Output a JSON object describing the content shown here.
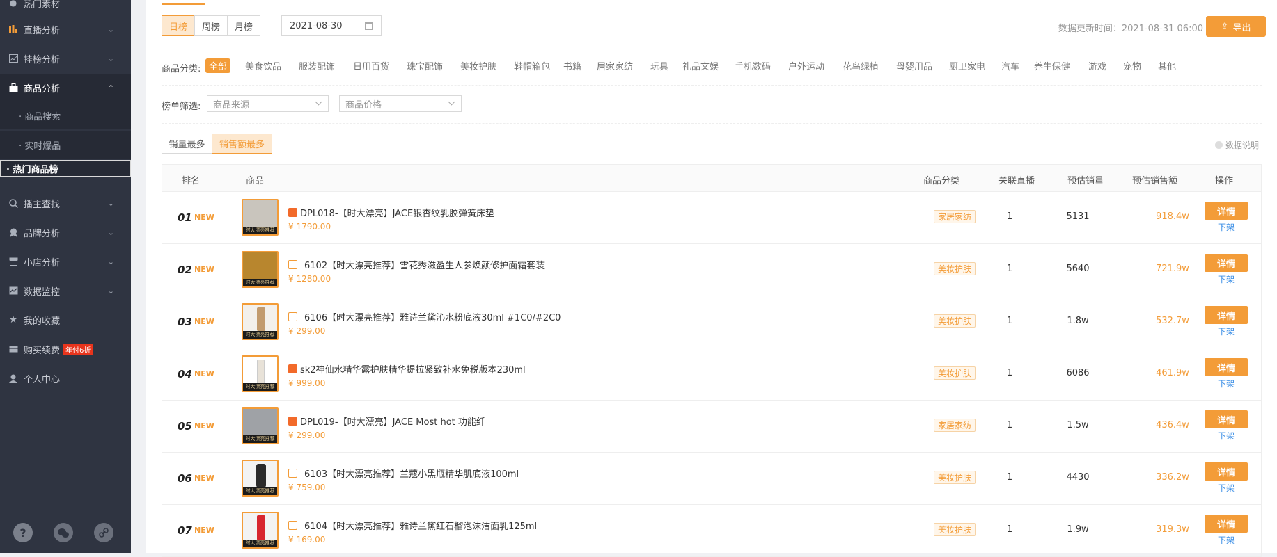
{
  "sidebar": {
    "top_item": "热门素材",
    "nav": [
      {
        "label": "直播分析",
        "icon": "bar-chart-icon"
      },
      {
        "label": "挂榜分析",
        "icon": "line-chart-icon"
      },
      {
        "label": "商品分析",
        "icon": "bag-icon"
      },
      {
        "label": "播主查找",
        "icon": "search-icon"
      },
      {
        "label": "品牌分析",
        "icon": "award-icon"
      },
      {
        "label": "小店分析",
        "icon": "shop-icon"
      },
      {
        "label": "数据监控",
        "icon": "monitor-icon"
      },
      {
        "label": "我的收藏",
        "icon": "star-icon"
      },
      {
        "label": "购买续费",
        "icon": "card-icon",
        "badge": "年付6折"
      },
      {
        "label": "个人中心",
        "icon": "user-icon"
      }
    ],
    "sub": [
      {
        "label": "· 商品搜索"
      },
      {
        "label": "· 实时爆品"
      },
      {
        "label": "· 热门商品榜"
      }
    ],
    "bottom": [
      "help-icon",
      "wechat-icon",
      "link-icon"
    ]
  },
  "toolbar": {
    "tabs": [
      "日榜",
      "周榜",
      "月榜"
    ],
    "date": "2021-08-30",
    "update_text": "数据更新时间：2021-08-31 06:00",
    "export_label": "导出"
  },
  "categories": {
    "label": "商品分类:",
    "items": [
      "全部",
      "美食饮品",
      "服装配饰",
      "日用百货",
      "珠宝配饰",
      "美妆护肤",
      "鞋帽箱包",
      "书籍",
      "居家家纺",
      "玩具",
      "礼品文娱",
      "手机数码",
      "户外运动",
      "花鸟绿植",
      "母婴用品",
      "厨卫家电",
      "汽车",
      "养生保健",
      "游戏",
      "宠物",
      "其他"
    ]
  },
  "filters": {
    "label": "榜单筛选:",
    "source_placeholder": "商品来源",
    "price_placeholder": "商品价格"
  },
  "sort": {
    "options": [
      "销量最多",
      "销售额最多"
    ],
    "info": "数据说明"
  },
  "table": {
    "headers": {
      "rank": "排名",
      "product": "商品",
      "category": "商品分类",
      "live": "关联直播",
      "sales": "预估销量",
      "amount": "预估销售额",
      "op": "操作"
    },
    "new_label": "NEW",
    "detail_label": "详情",
    "off_label": "下架",
    "thumb_caption": "时大漂亮推荐",
    "rows": [
      {
        "rank": "01",
        "title": "DPL018-【时大漂亮】JACE银杏纹乳胶弹簧床垫",
        "price": "¥ 1790.00",
        "category": "家居家纺",
        "live": "1",
        "sales": "5131",
        "amount": "918.4w",
        "platform": "a",
        "thumb": "#c9c5bd"
      },
      {
        "rank": "02",
        "title": "6102【时大漂亮推荐】雪花秀滋盈生人参焕颜修护面霜套装",
        "price": "¥ 1280.00",
        "category": "美妆护肤",
        "live": "1",
        "sales": "5640",
        "amount": "721.9w",
        "platform": "b",
        "thumb": "#b8862e"
      },
      {
        "rank": "03",
        "title": "6106【时大漂亮推荐】雅诗兰黛沁水粉底液30ml #1C0/#2C0",
        "price": "¥ 299.00",
        "category": "美妆护肤",
        "live": "1",
        "sales": "1.8w",
        "amount": "532.7w",
        "platform": "b",
        "thumb": "#c29b6f"
      },
      {
        "rank": "04",
        "title": "sk2神仙水精华露护肤精华提拉紧致补水免税版本230ml",
        "price": "¥ 999.00",
        "category": "美妆护肤",
        "live": "1",
        "sales": "6086",
        "amount": "461.9w",
        "platform": "a",
        "thumb": "#e9e4dd"
      },
      {
        "rank": "05",
        "title": "DPL019-【时大漂亮】JACE Most hot 功能纤",
        "price": "¥ 299.00",
        "category": "家居家纺",
        "live": "1",
        "sales": "1.5w",
        "amount": "436.4w",
        "platform": "a",
        "thumb": "#9fa2a6"
      },
      {
        "rank": "06",
        "title": "6103【时大漂亮推荐】兰蔻小黑瓶精华肌底液100ml",
        "price": "¥ 759.00",
        "category": "美妆护肤",
        "live": "1",
        "sales": "4430",
        "amount": "336.2w",
        "platform": "b",
        "thumb": "#2b2b2b"
      },
      {
        "rank": "07",
        "title": "6104【时大漂亮推荐】雅诗兰黛红石榴泡沫洁面乳125ml",
        "price": "¥ 169.00",
        "category": "美妆护肤",
        "live": "1",
        "sales": "1.9w",
        "amount": "319.3w",
        "platform": "b",
        "thumb": "#d8262f"
      }
    ]
  }
}
